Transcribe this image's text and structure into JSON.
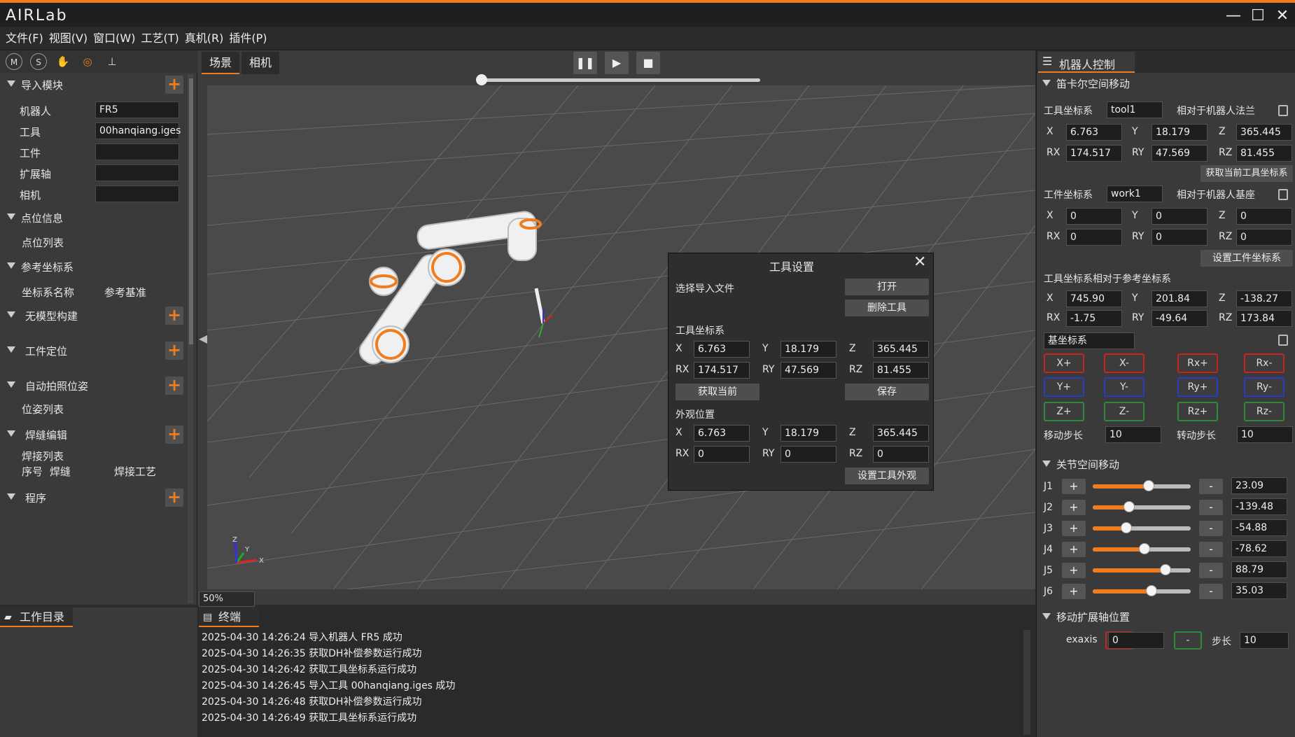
{
  "app": {
    "title": "AIRLab",
    "window_buttons": [
      "minimize-icon",
      "maximize-icon",
      "close-icon"
    ]
  },
  "menu": [
    "文件(F)",
    "视图(V)",
    "窗口(W)",
    "工艺(T)",
    "真机(R)",
    "插件(P)"
  ],
  "left_toolbar": {
    "icons": [
      "M",
      "S",
      "hand-icon",
      "target-icon",
      "axis-icon"
    ]
  },
  "left_tree": {
    "import": {
      "label": "导入模块",
      "robot_label": "机器人",
      "robot_value": "FR5",
      "tool_label": "工具",
      "tool_value": "00hanqiang.iges",
      "workpiece_label": "工件",
      "workpiece_value": "",
      "ext_axis_label": "扩展轴",
      "ext_axis_value": "",
      "camera_label": "相机",
      "camera_value": ""
    },
    "points": {
      "label": "点位信息",
      "list": "点位列表"
    },
    "ref": {
      "label": "参考坐标系",
      "col1": "坐标系名称",
      "col2": "参考基准"
    },
    "nomodel": {
      "label": "无模型构建"
    },
    "workpos": {
      "label": "工件定位"
    },
    "autophoto": {
      "label": "自动拍照位姿",
      "list": "位姿列表"
    },
    "weld": {
      "label": "焊缝编辑",
      "list": "焊接列表",
      "col1": "序号",
      "col2": "焊缝",
      "col3": "焊接工艺"
    },
    "program": {
      "label": "程序"
    }
  },
  "center": {
    "tab_scene": "场景",
    "tab_camera": "相机",
    "zoom": "50%",
    "playback_progress": 0
  },
  "dialog": {
    "title": "工具设置",
    "choose_file": "选择导入文件",
    "open_btn": "打开",
    "delete_btn": "删除工具",
    "tool_frame": "工具坐标系",
    "x": "6.763",
    "y": "18.179",
    "z": "365.445",
    "rx": "174.517",
    "ry": "47.569",
    "rz": "81.455",
    "get_current": "获取当前",
    "save": "保存",
    "appearance": "外观位置",
    "ax": "6.763",
    "ay": "18.179",
    "az": "365.445",
    "arx": "0",
    "ary": "0",
    "arz": "0",
    "set_appearance": "设置工具外观",
    "labels": {
      "x": "X",
      "y": "Y",
      "z": "Z",
      "rx": "RX",
      "ry": "RY",
      "rz": "RZ"
    }
  },
  "right": {
    "tab": "机器人控制",
    "cartesian": "笛卡尔空间移动",
    "tool_frame_label": "工具坐标系",
    "tool_frame_value": "tool1",
    "tool_rel": "相对于机器人法兰",
    "tx": "6.763",
    "ty": "18.179",
    "tz": "365.445",
    "trx": "174.517",
    "try": "47.569",
    "trz": "81.455",
    "get_tool": "获取当前工具坐标系",
    "work_frame_label": "工件坐标系",
    "work_frame_value": "work1",
    "work_rel": "相对于机器人基座",
    "wx": "0",
    "wy": "0",
    "wz": "0",
    "wrx": "0",
    "wry": "0",
    "wrz": "0",
    "set_work": "设置工件坐标系",
    "tool_ref": "工具坐标系相对于参考坐标系",
    "px": "745.90",
    "py": "201.84",
    "pz": "-138.27",
    "prx": "-1.75",
    "pry": "-49.64",
    "prz": "173.84",
    "base_frame": "基坐标系",
    "jog": [
      "X+",
      "X-",
      "Rx+",
      "Rx-",
      "Y+",
      "Y-",
      "Ry+",
      "Ry-",
      "Z+",
      "Z-",
      "Rz+",
      "Rz-"
    ],
    "move_step_label": "移动步长",
    "move_step": "10",
    "rot_step_label": "转动步长",
    "rot_step": "10",
    "joint_title": "关节空间移动",
    "joints": [
      {
        "name": "J1",
        "value": "23.09",
        "level": 0.57
      },
      {
        "name": "J2",
        "value": "-139.48",
        "level": 0.37
      },
      {
        "name": "J3",
        "value": "-54.88",
        "level": 0.34
      },
      {
        "name": "J4",
        "value": "-78.62",
        "level": 0.53
      },
      {
        "name": "J5",
        "value": "88.79",
        "level": 0.74
      },
      {
        "name": "J6",
        "value": "35.03",
        "level": 0.6
      }
    ],
    "plus": "+",
    "minus": "-",
    "ext_title": "移动扩展轴位置",
    "exaxis_label": "exaxis",
    "exaxis_value": "0",
    "ext_step_label": "步长",
    "ext_step": "10",
    "labels": {
      "x": "X",
      "y": "Y",
      "z": "Z",
      "rx": "RX",
      "ry": "RY",
      "rz": "RZ"
    }
  },
  "bottom": {
    "workdir": "工作目录",
    "terminal": "终端",
    "logs": [
      "2025-04-30 14:26:24 导入机器人 FR5 成功",
      "2025-04-30 14:26:35 获取DH补偿参数运行成功",
      "2025-04-30 14:26:42 获取工具坐标系运行成功",
      "2025-04-30 14:26:45 导入工具 00hanqiang.iges 成功",
      "2025-04-30 14:26:48 获取DH补偿参数运行成功",
      "2025-04-30 14:26:49 获取工具坐标系运行成功"
    ]
  },
  "colors": {
    "accent": "#ef7d1f",
    "jog_red": "#c92222",
    "jog_blue": "#2a3cc4",
    "jog_green": "#2f8a3a"
  }
}
